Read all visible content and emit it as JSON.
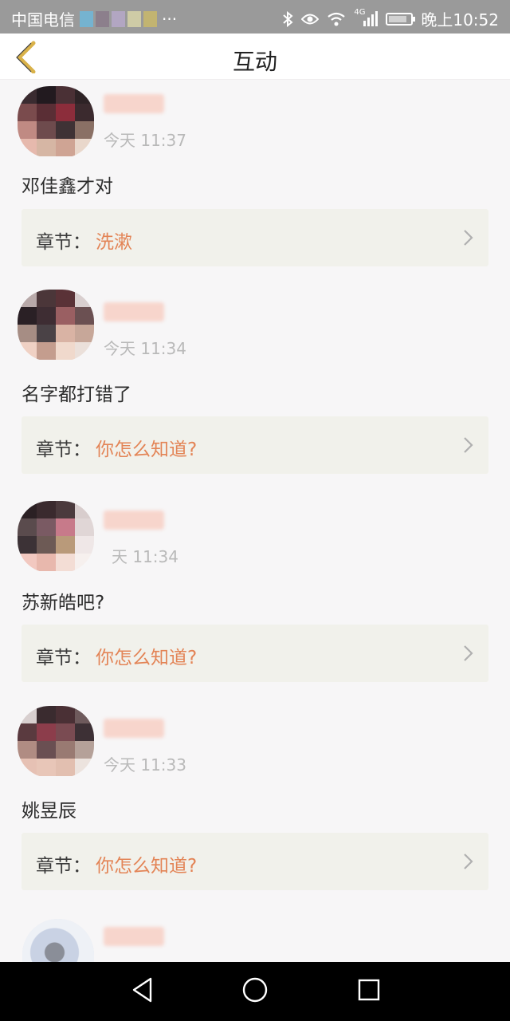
{
  "status_bar": {
    "carrier": "中国电信",
    "more": "···",
    "network": "4G",
    "time": "晚上10:52"
  },
  "header": {
    "title": "互动",
    "back_icon": "chevron-left-icon"
  },
  "posts": [
    {
      "time": "今天 11:37",
      "comment": "邓佳鑫才对",
      "chapter_label": "章节：",
      "chapter": "洗漱"
    },
    {
      "time": "今天 11:34",
      "comment": "名字都打错了",
      "chapter_label": "章节：",
      "chapter": "你怎么知道?"
    },
    {
      "time": "天 11:34",
      "comment": "苏新皓吧?",
      "chapter_label": "章节：",
      "chapter": "你怎么知道?"
    },
    {
      "time": "今天 11:33",
      "comment": "姚昱辰",
      "chapter_label": "章节：",
      "chapter": "你怎么知道?"
    }
  ],
  "nav": {
    "back_icon": "triangle-back-icon",
    "home_icon": "circle-home-icon",
    "recent_icon": "square-recents-icon"
  },
  "colors": {
    "accent": "#e38456",
    "back_arrow": "#d9b24a",
    "status_bar": "#9a9a9a",
    "card_bg": "#f1f1eb"
  }
}
